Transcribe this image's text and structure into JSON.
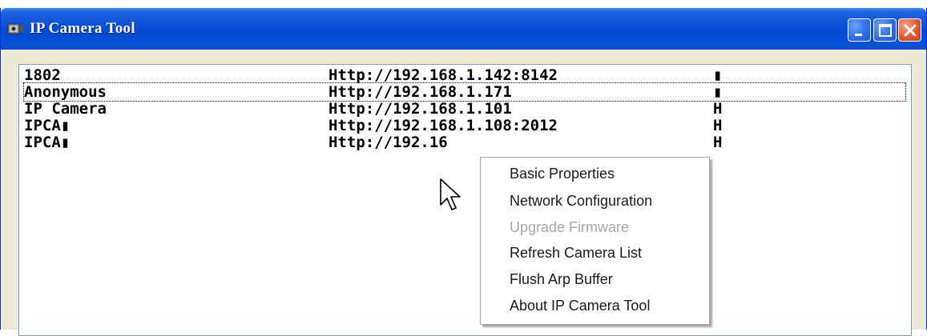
{
  "window": {
    "title": "IP Camera Tool",
    "accent_color": "#0a4fd6",
    "icons": {
      "app": "camera-app-icon",
      "minimize": "minimize-icon",
      "maximize": "maximize-icon",
      "close": "close-icon"
    }
  },
  "camera_list": {
    "rows": [
      {
        "name": "1802",
        "url": "Http://192.168.1.142:8142",
        "flag": "▮"
      },
      {
        "name": "Anonymous",
        "url": "Http://192.168.1.171",
        "flag": "▮"
      },
      {
        "name": "IP Camera",
        "url": "Http://192.168.1.101",
        "flag": "H"
      },
      {
        "name": "IPCA▮",
        "url": "Http://192.168.1.108:2012",
        "flag": "H"
      },
      {
        "name": "IPCA▮",
        "url": "Http://192.16",
        "flag": "H"
      }
    ],
    "focused_row": 1
  },
  "context_menu": {
    "items": [
      {
        "label": "Basic Properties",
        "enabled": true
      },
      {
        "label": "Network Configuration",
        "enabled": true
      },
      {
        "label": "Upgrade Firmware",
        "enabled": false
      },
      {
        "label": "Refresh Camera List",
        "enabled": true
      },
      {
        "label": "Flush Arp Buffer",
        "enabled": true
      },
      {
        "label": "About IP Camera Tool",
        "enabled": true
      }
    ]
  },
  "cursor": {
    "icon": "mouse-pointer-icon"
  }
}
